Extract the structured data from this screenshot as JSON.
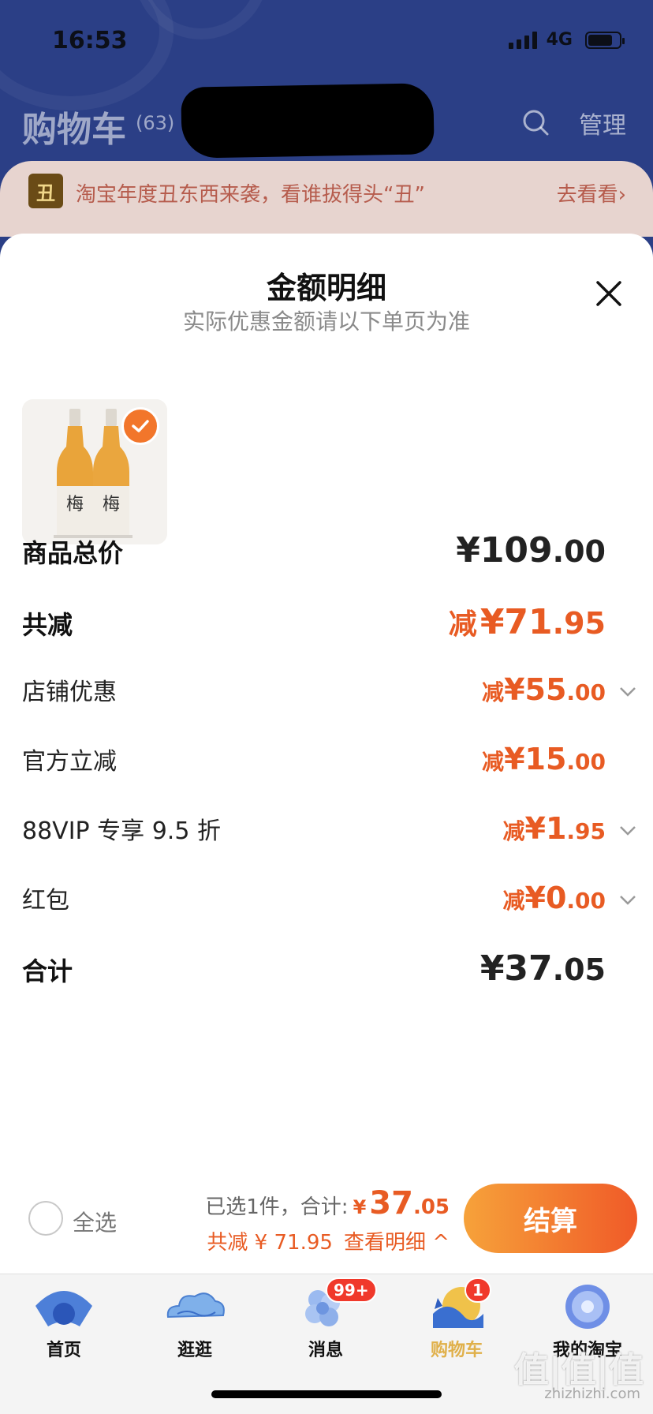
{
  "status_bar": {
    "time": "16:53",
    "network": "4G",
    "battery_level": 0.8
  },
  "header": {
    "title": "购物车",
    "count": "(63)",
    "manage": "管理"
  },
  "banner": {
    "logo_char": "丑",
    "text": "淘宝年度丑东西来袭，看谁拔得头“丑”",
    "link": "去看看›"
  },
  "sheet": {
    "title": "金额明细",
    "subtitle": "实际优惠金额请以下单页为准",
    "rows": [
      {
        "label": "商品总价",
        "prefix": "",
        "int": "¥109",
        "dec": ".00"
      },
      {
        "label": "共减",
        "prefix": "减",
        "int": "¥71",
        "dec": ".95"
      },
      {
        "label": "店铺优惠",
        "prefix": "减",
        "int": "¥55",
        "dec": ".00"
      },
      {
        "label": "官方立减",
        "prefix": "减",
        "int": "¥15",
        "dec": ".00"
      },
      {
        "label": "88VIP 专享 9.5 折",
        "prefix": "减",
        "int": "¥1",
        "dec": ".95"
      },
      {
        "label": "红包",
        "prefix": "减",
        "int": "¥0",
        "dec": ".00"
      },
      {
        "label": "合计",
        "prefix": "",
        "int": "¥37",
        "dec": ".05"
      }
    ]
  },
  "checkout": {
    "select_all": "全选",
    "selected_text": "已选1件，合计:",
    "currency": "¥",
    "total_int": "37",
    "total_dec": ".05",
    "discount_text": "共减 ¥ 71.95",
    "details_link": "查看明细 ^",
    "button": "结算"
  },
  "tabbar": {
    "tabs": [
      {
        "label": "首页"
      },
      {
        "label": "逛逛"
      },
      {
        "label": "消息",
        "badge": "99+"
      },
      {
        "label": "购物车",
        "badge": "1"
      },
      {
        "label": "我的淘宝"
      }
    ]
  },
  "watermark": {
    "text": "值|值|值",
    "sub": "zhizhizhi.com"
  },
  "colors": {
    "accent": "#e85b23",
    "header_bg": "#2b3f86",
    "active_tab": "#e0b04a"
  }
}
